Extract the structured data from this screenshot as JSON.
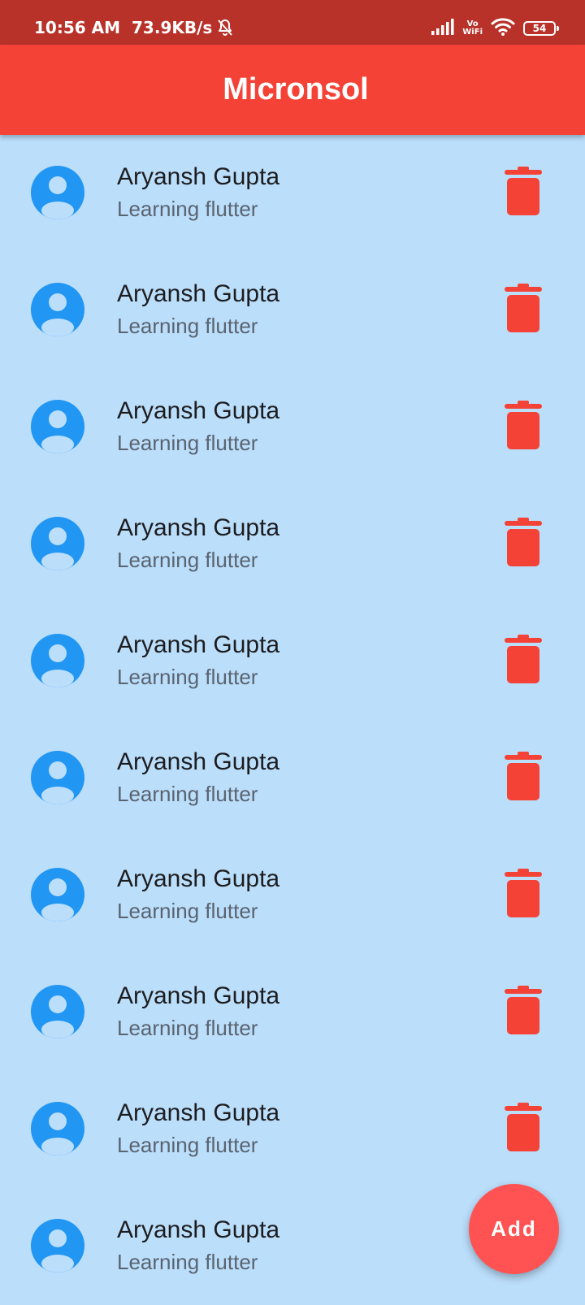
{
  "status_bar": {
    "time": "10:56 AM",
    "net_speed": "73.9KB/s",
    "vowifi_top": "Vo",
    "vowifi_bottom": "WiFi",
    "battery": "54"
  },
  "app_bar": {
    "title": "Micronsol"
  },
  "list": {
    "items": [
      {
        "title": "Aryansh Gupta",
        "subtitle": "Learning flutter"
      },
      {
        "title": "Aryansh Gupta",
        "subtitle": "Learning flutter"
      },
      {
        "title": "Aryansh Gupta",
        "subtitle": "Learning flutter"
      },
      {
        "title": "Aryansh Gupta",
        "subtitle": "Learning flutter"
      },
      {
        "title": "Aryansh Gupta",
        "subtitle": "Learning flutter"
      },
      {
        "title": "Aryansh Gupta",
        "subtitle": "Learning flutter"
      },
      {
        "title": "Aryansh Gupta",
        "subtitle": "Learning flutter"
      },
      {
        "title": "Aryansh Gupta",
        "subtitle": "Learning flutter"
      },
      {
        "title": "Aryansh Gupta",
        "subtitle": "Learning flutter"
      },
      {
        "title": "Aryansh Gupta",
        "subtitle": "Learning flutter"
      }
    ]
  },
  "fab": {
    "label": "Add"
  },
  "icons": {
    "avatar": "account-circle-icon",
    "delete": "trash-icon"
  },
  "colors": {
    "status_bar": "#b8322a",
    "app_bar": "#f44336",
    "background": "#bbdefb",
    "avatar": "#2196f3",
    "delete": "#f44336",
    "fab": "#ff5252"
  }
}
